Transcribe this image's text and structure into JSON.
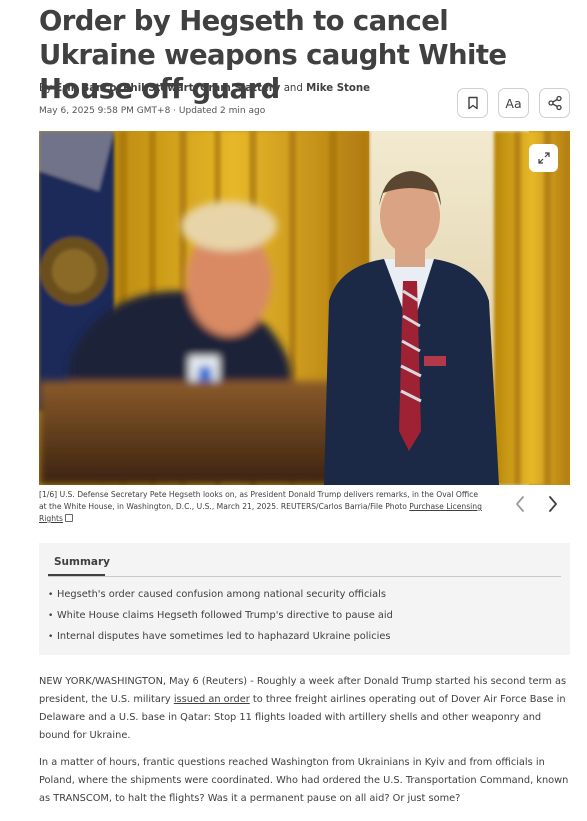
{
  "article": {
    "headline": "Order by Hegseth to cancel Ukraine weapons caught White House off guard",
    "byline_prefix": "By ",
    "authors": [
      "Erin Banco",
      "Phil Stewart",
      "Gram Slattery",
      "Mike Stone"
    ],
    "byline_sep1": ", ",
    "byline_sep2": ", ",
    "byline_and": " and ",
    "dateline": "May 6, 2025 9:58 PM GMT+8 · Updated 2 min ago"
  },
  "toolbar": {
    "bookmark_icon": "bookmark-icon",
    "text_size_label": "Aa",
    "share_icon": "share-icon"
  },
  "photo": {
    "expand_icon": "expand-icon",
    "caption_counter": "[1/6]",
    "caption_text": " U.S. Defense Secretary Pete Hegseth looks on, as President Donald Trump delivers remarks, in the Oval Office at the White House, in Washington, D.C., U.S., March 21, 2025. REUTERS/Carlos Barria/File Photo ",
    "caption_link": "Purchase Licensing Rights",
    "prev_icon": "chevron-left-icon",
    "next_icon": "chevron-right-icon"
  },
  "summary": {
    "title": "Summary",
    "items": [
      "Hegseth's order caused confusion among national security officials",
      "White House claims Hegseth followed Trump's directive to pause aid",
      "Internal disputes have sometimes led to haphazard Ukraine policies"
    ]
  },
  "body": {
    "p1_before": "NEW YORK/WASHINGTON, May 6 (Reuters) - Roughly a week after Donald Trump started his second term as president, the U.S. military ",
    "p1_link": "issued an order",
    "p1_after": " to three freight airlines operating out of Dover Air Force Base in Delaware and a U.S. base in Qatar: Stop 11 flights loaded with artillery shells and other weaponry and bound for Ukraine.",
    "p2": "In a matter of hours, frantic questions reached Washington from Ukrainians in Kyiv and from officials in Poland, where the shipments were coordinated. Who had ordered the U.S. Transportation Command, known as TRANSCOM, to halt the flights? Was it a permanent pause on all aid? Or just some?"
  },
  "colors": {
    "text": "#404040",
    "summary_bg": "#f4f4f4",
    "curtain_gold": "#d4a21c"
  }
}
